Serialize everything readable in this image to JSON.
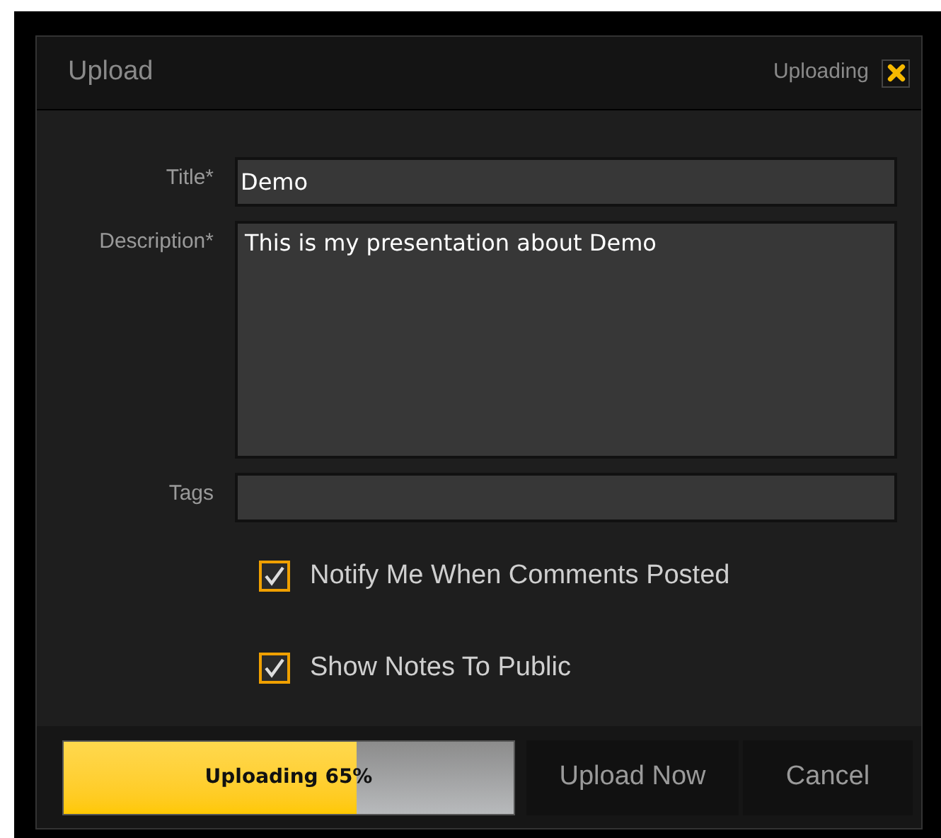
{
  "window": {
    "title": "Upload",
    "status": "Uploading"
  },
  "fields": [
    {
      "label": "Title*",
      "value": "Demo",
      "kind": "line"
    },
    {
      "label": "Description*",
      "value": "This is my presentation about Demo",
      "kind": "area"
    },
    {
      "label": "Tags",
      "kind": "line"
    }
  ],
  "options": [
    {
      "label": "Notify Me When Comments Posted",
      "checked": true
    },
    {
      "label": "Show Notes To Public",
      "checked": true
    }
  ],
  "progress": {
    "text": "Uploading 65%",
    "level": 0.65
  },
  "buttons": [
    "Upload Now",
    "Cancel"
  ]
}
